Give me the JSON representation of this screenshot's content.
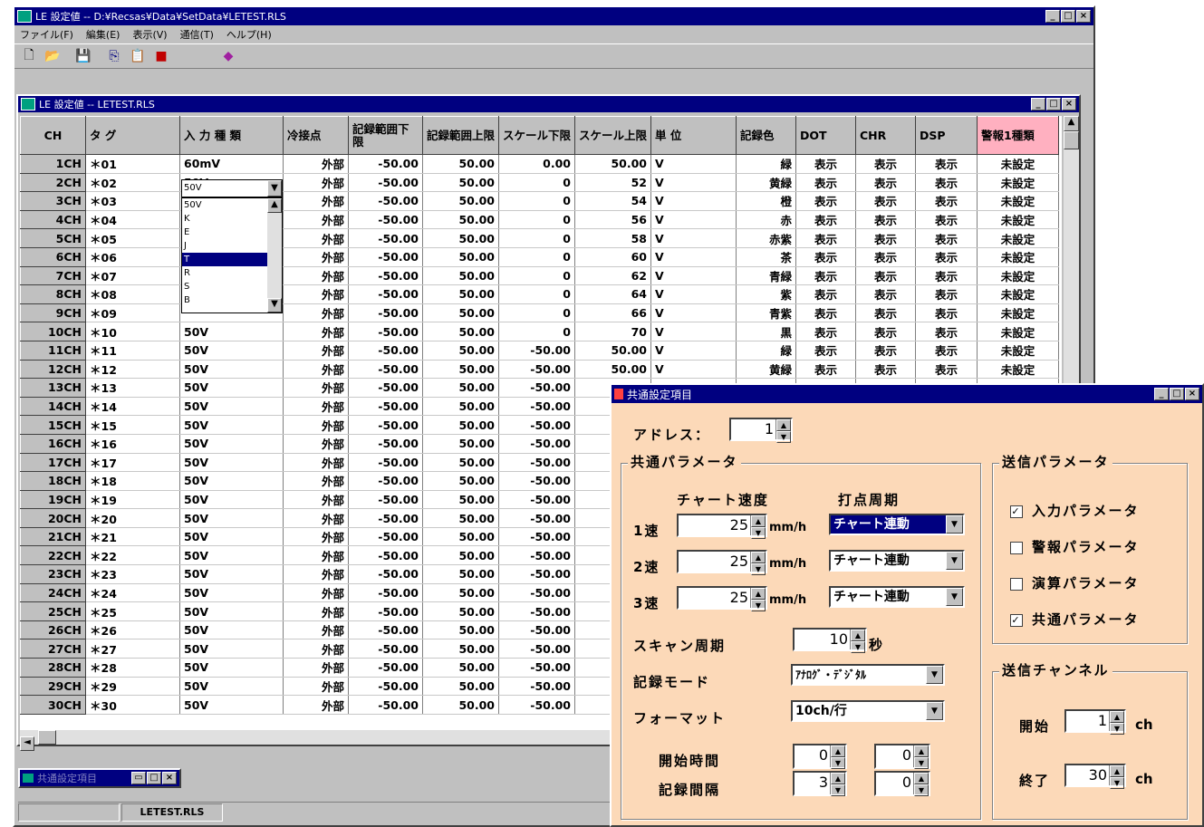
{
  "main_window": {
    "title": "LE 設定値 -- D:¥Recsas¥Data¥SetData¥LETEST.RLS",
    "menu": [
      "ファイル(F)",
      "編集(E)",
      "表示(V)",
      "通信(T)",
      "ヘルプ(H)"
    ],
    "toolbar_icons": [
      "new-file-icon",
      "open-folder-icon",
      "save-icon",
      "copy-icon",
      "paste-icon",
      "exit-icon",
      "book-icon"
    ]
  },
  "child_window": {
    "title": "LE 設定値 -- LETEST.RLS",
    "columns": [
      "CH",
      "タ グ",
      "入 力 種 類",
      "冷接点",
      "記録範囲下限",
      "記録範囲上限",
      "スケール下限",
      "スケール上限",
      "単 位",
      "記録色",
      "DOT",
      "CHR",
      "DSP",
      "警報1種類"
    ],
    "rows": [
      [
        "1CH",
        "＊01",
        "60mV",
        "外部",
        "-50.00",
        "50.00",
        "0.00",
        "50.00",
        "V",
        "緑",
        "表示",
        "表示",
        "表示",
        "未設定"
      ],
      [
        "2CH",
        "＊02",
        "50V",
        "外部",
        "-50.00",
        "50.00",
        "0",
        "52",
        "V",
        "黄緑",
        "表示",
        "表示",
        "表示",
        "未設定"
      ],
      [
        "3CH",
        "＊03",
        "50V",
        "外部",
        "-50.00",
        "50.00",
        "0",
        "54",
        "V",
        "橙",
        "表示",
        "表示",
        "表示",
        "未設定"
      ],
      [
        "4CH",
        "＊04",
        "",
        "外部",
        "-50.00",
        "50.00",
        "0",
        "56",
        "V",
        "赤",
        "表示",
        "表示",
        "表示",
        "未設定"
      ],
      [
        "5CH",
        "＊05",
        "",
        "外部",
        "-50.00",
        "50.00",
        "0",
        "58",
        "V",
        "赤紫",
        "表示",
        "表示",
        "表示",
        "未設定"
      ],
      [
        "6CH",
        "＊06",
        "",
        "外部",
        "-50.00",
        "50.00",
        "0",
        "60",
        "V",
        "茶",
        "表示",
        "表示",
        "表示",
        "未設定"
      ],
      [
        "7CH",
        "＊07",
        "",
        "外部",
        "-50.00",
        "50.00",
        "0",
        "62",
        "V",
        "青緑",
        "表示",
        "表示",
        "表示",
        "未設定"
      ],
      [
        "8CH",
        "＊08",
        "",
        "外部",
        "-50.00",
        "50.00",
        "0",
        "64",
        "V",
        "紫",
        "表示",
        "表示",
        "表示",
        "未設定"
      ],
      [
        "9CH",
        "＊09",
        "",
        "外部",
        "-50.00",
        "50.00",
        "0",
        "66",
        "V",
        "青紫",
        "表示",
        "表示",
        "表示",
        "未設定"
      ],
      [
        "10CH",
        "＊10",
        "50V",
        "外部",
        "-50.00",
        "50.00",
        "0",
        "70",
        "V",
        "黒",
        "表示",
        "表示",
        "表示",
        "未設定"
      ],
      [
        "11CH",
        "＊11",
        "50V",
        "外部",
        "-50.00",
        "50.00",
        "-50.00",
        "50.00",
        "V",
        "緑",
        "表示",
        "表示",
        "表示",
        "未設定"
      ],
      [
        "12CH",
        "＊12",
        "50V",
        "外部",
        "-50.00",
        "50.00",
        "-50.00",
        "50.00",
        "V",
        "黄緑",
        "表示",
        "表示",
        "表示",
        "未設定"
      ],
      [
        "13CH",
        "＊13",
        "50V",
        "外部",
        "-50.00",
        "50.00",
        "-50.00",
        "",
        "",
        "",
        "",
        "",
        "",
        ""
      ],
      [
        "14CH",
        "＊14",
        "50V",
        "外部",
        "-50.00",
        "50.00",
        "-50.00",
        "",
        "",
        "",
        "",
        "",
        "",
        ""
      ],
      [
        "15CH",
        "＊15",
        "50V",
        "外部",
        "-50.00",
        "50.00",
        "-50.00",
        "",
        "",
        "",
        "",
        "",
        "",
        ""
      ],
      [
        "16CH",
        "＊16",
        "50V",
        "外部",
        "-50.00",
        "50.00",
        "-50.00",
        "",
        "",
        "",
        "",
        "",
        "",
        ""
      ],
      [
        "17CH",
        "＊17",
        "50V",
        "外部",
        "-50.00",
        "50.00",
        "-50.00",
        "",
        "",
        "",
        "",
        "",
        "",
        ""
      ],
      [
        "18CH",
        "＊18",
        "50V",
        "外部",
        "-50.00",
        "50.00",
        "-50.00",
        "",
        "",
        "",
        "",
        "",
        "",
        ""
      ],
      [
        "19CH",
        "＊19",
        "50V",
        "外部",
        "-50.00",
        "50.00",
        "-50.00",
        "",
        "",
        "",
        "",
        "",
        "",
        ""
      ],
      [
        "20CH",
        "＊20",
        "50V",
        "外部",
        "-50.00",
        "50.00",
        "-50.00",
        "",
        "",
        "",
        "",
        "",
        "",
        ""
      ],
      [
        "21CH",
        "＊21",
        "50V",
        "外部",
        "-50.00",
        "50.00",
        "-50.00",
        "",
        "",
        "",
        "",
        "",
        "",
        ""
      ],
      [
        "22CH",
        "＊22",
        "50V",
        "外部",
        "-50.00",
        "50.00",
        "-50.00",
        "",
        "",
        "",
        "",
        "",
        "",
        ""
      ],
      [
        "23CH",
        "＊23",
        "50V",
        "外部",
        "-50.00",
        "50.00",
        "-50.00",
        "",
        "",
        "",
        "",
        "",
        "",
        ""
      ],
      [
        "24CH",
        "＊24",
        "50V",
        "外部",
        "-50.00",
        "50.00",
        "-50.00",
        "",
        "",
        "",
        "",
        "",
        "",
        ""
      ],
      [
        "25CH",
        "＊25",
        "50V",
        "外部",
        "-50.00",
        "50.00",
        "-50.00",
        "",
        "",
        "",
        "",
        "",
        "",
        ""
      ],
      [
        "26CH",
        "＊26",
        "50V",
        "外部",
        "-50.00",
        "50.00",
        "-50.00",
        "",
        "",
        "",
        "",
        "",
        "",
        ""
      ],
      [
        "27CH",
        "＊27",
        "50V",
        "外部",
        "-50.00",
        "50.00",
        "-50.00",
        "",
        "",
        "",
        "",
        "",
        "",
        ""
      ],
      [
        "28CH",
        "＊28",
        "50V",
        "外部",
        "-50.00",
        "50.00",
        "-50.00",
        "",
        "",
        "",
        "",
        "",
        "",
        ""
      ],
      [
        "29CH",
        "＊29",
        "50V",
        "外部",
        "-50.00",
        "50.00",
        "-50.00",
        "",
        "",
        "",
        "",
        "",
        "",
        ""
      ],
      [
        "30CH",
        "＊30",
        "50V",
        "外部",
        "-50.00",
        "50.00",
        "-50.00",
        "",
        "",
        "",
        "",
        "",
        "",
        ""
      ]
    ],
    "input_type_dropdown": {
      "current": "50V",
      "options": [
        "50V",
        "K",
        "E",
        "J",
        "T",
        "R",
        "S",
        "B"
      ],
      "highlighted_index": 4
    },
    "minimized_window_label": "共通設定項目",
    "status_text": "LETEST.RLS"
  },
  "common_dialog": {
    "title": "共通設定項目",
    "address_label": "アドレス：",
    "address_value": "1",
    "common_params_label": "共通パラメータ",
    "chart_speed_header": "チャート速度",
    "dot_period_header": "打点周期",
    "speeds": [
      {
        "label": "1速",
        "value": "25",
        "unit": "mm/h",
        "period": "チャート連動"
      },
      {
        "label": "2速",
        "value": "25",
        "unit": "mm/h",
        "period": "チャート連動"
      },
      {
        "label": "3速",
        "value": "25",
        "unit": "mm/h",
        "period": "チャート連動"
      }
    ],
    "scan_period_label": "スキャン周期",
    "scan_period_value": "10",
    "scan_period_unit": "秒",
    "record_mode_label": "記録モード",
    "record_mode_value": "ｱﾅﾛｸﾞ・ﾃﾞｼﾞﾀﾙ",
    "format_label": "フォーマット",
    "format_value": "10ch/行",
    "start_time_label": "開始時間",
    "record_interval_label": "記録間隔",
    "start_time_values": [
      "0",
      "0"
    ],
    "record_interval_values": [
      "3",
      "0"
    ],
    "send_params_label": "送信パラメータ",
    "send_params": [
      {
        "label": "入力パラメータ",
        "checked": true
      },
      {
        "label": "警報パラメータ",
        "checked": false
      },
      {
        "label": "演算パラメータ",
        "checked": false
      },
      {
        "label": "共通パラメータ",
        "checked": true
      }
    ],
    "send_channel_label": "送信チャンネル",
    "start_label": "開始",
    "start_value": "1",
    "end_label": "終了",
    "end_value": "30",
    "ch_unit": "ch"
  }
}
